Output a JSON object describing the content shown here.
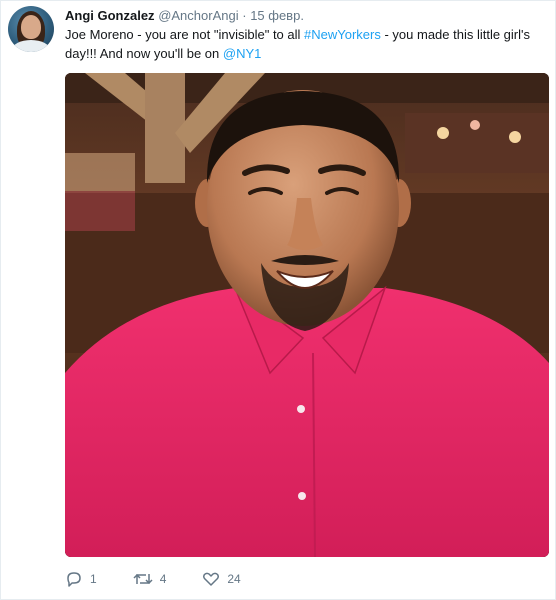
{
  "tweet": {
    "author_name": "Angi Gonzalez",
    "author_handle": "@AnchorAngi",
    "separator": "·",
    "date": "15 февр.",
    "text_parts": {
      "t1": "Joe Moreno - you are not \"invisible\" to all ",
      "hashtag": "#NewYorkers",
      "t2": " - you made this little girl's day!!! And now you'll be on ",
      "mention": "@NY1"
    },
    "reply_count": "1",
    "retweet_count": "4",
    "like_count": "24"
  },
  "colors": {
    "link": "#1da1f2",
    "muted": "#657786",
    "shirt": "#e0245e"
  },
  "icons": {
    "reply": "reply-icon",
    "retweet": "retweet-icon",
    "like": "heart-icon"
  }
}
